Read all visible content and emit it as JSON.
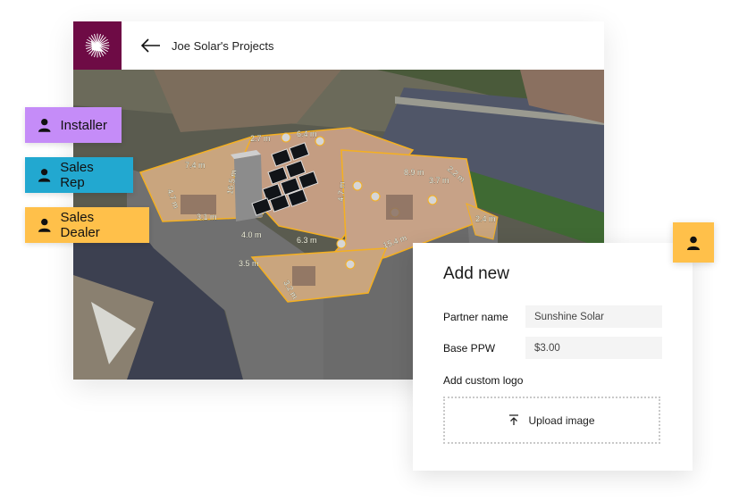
{
  "app": {
    "title": "Joe Solar's Projects",
    "brand_color": "#6e0b45",
    "logo_icon": "sunburst-logo-icon",
    "back_icon": "arrow-left-icon"
  },
  "roles": [
    {
      "label": "Installer",
      "color": "#c58cf8",
      "icon": "person-icon"
    },
    {
      "label": "Sales Rep",
      "color": "#22a8d0",
      "icon": "person-icon"
    },
    {
      "label": "Sales Dealer",
      "color": "#ffc04a",
      "icon": "person-icon"
    }
  ],
  "map": {
    "measurements": [
      "7.4 m",
      "2.7 m",
      "6.4 m",
      "4.7 m",
      "3.1 m",
      "16.5 m",
      "4.0 m",
      "6.3 m",
      "4.7 m",
      "3.5 m",
      "8.9 m",
      "3.7 m",
      "2.2 m",
      "2.4 m",
      "15.4 m",
      "3.2 m"
    ]
  },
  "panel": {
    "title": "Add new",
    "fields": [
      {
        "label": "Partner name",
        "value": "Sunshine Solar"
      },
      {
        "label": "Base PPW",
        "value": "$3.00"
      }
    ],
    "logo_label": "Add custom logo",
    "upload_label": "Upload image",
    "upload_icon": "upload-icon"
  },
  "avatar_badge": {
    "icon": "person-icon",
    "color": "#ffc04a"
  }
}
